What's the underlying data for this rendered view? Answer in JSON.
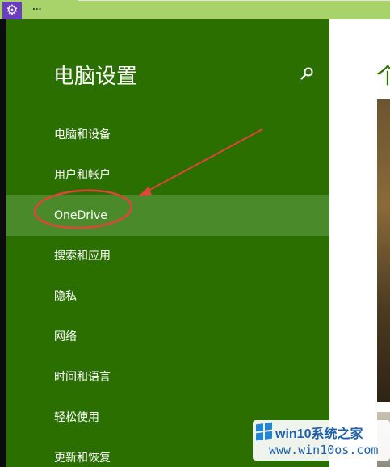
{
  "topbar": {
    "app_icon": "gear-icon",
    "overflow": "..."
  },
  "settings": {
    "title": "电脑设置",
    "search_icon": "search-icon",
    "nav_items": [
      {
        "label": "电脑和设备",
        "selected": false
      },
      {
        "label": "用户和帐户",
        "selected": false
      },
      {
        "label": "OneDrive",
        "selected": true
      },
      {
        "label": "搜索和应用",
        "selected": false
      },
      {
        "label": "隐私",
        "selected": false
      },
      {
        "label": "网络",
        "selected": false
      },
      {
        "label": "时间和语言",
        "selected": false
      },
      {
        "label": "轻松使用",
        "selected": false
      },
      {
        "label": "更新和恢复",
        "selected": false
      }
    ]
  },
  "content": {
    "title_partial": "个"
  },
  "annotation": {
    "color": "#e0443a",
    "circle_target": "OneDrive",
    "arrow": "pointing to OneDrive"
  },
  "watermark": {
    "title": "win10系统之家",
    "url": "www.win10os.com"
  },
  "colors": {
    "pane_green": "#2a6f00",
    "selected_green": "#4a8a2a",
    "topbar_green": "#a8d26a",
    "badge_purple": "#6a3fbf"
  }
}
